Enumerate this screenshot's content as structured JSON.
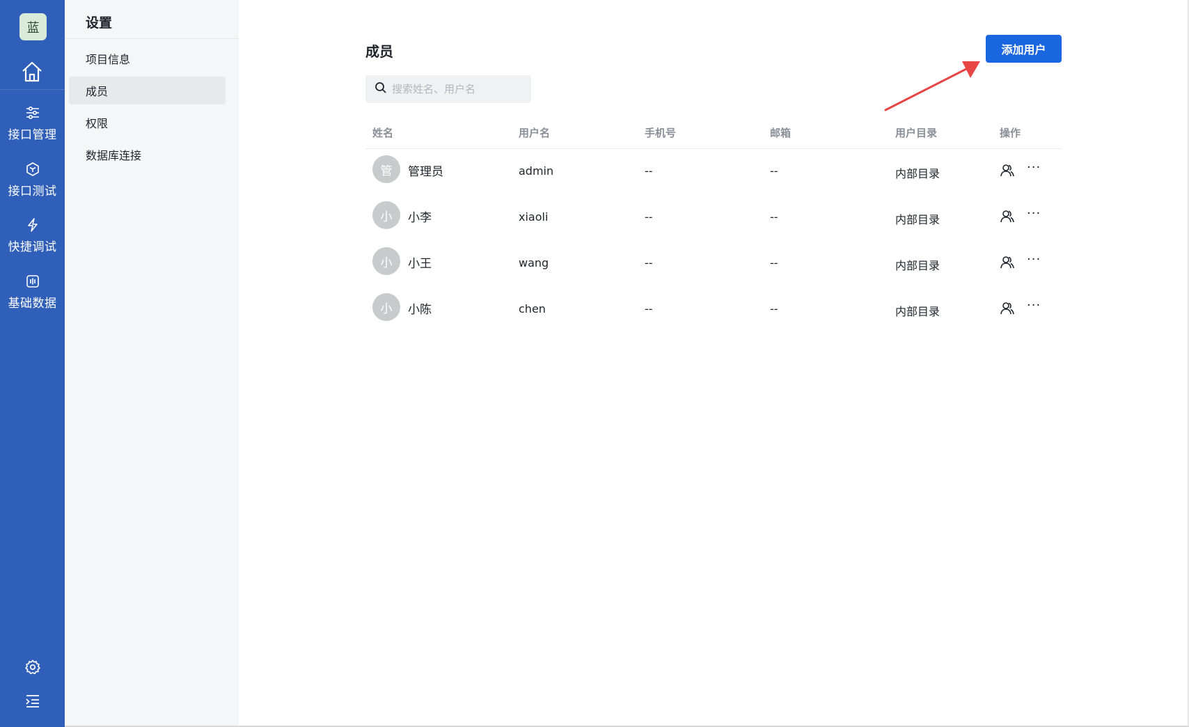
{
  "brand": {
    "label": "蓝"
  },
  "rail": {
    "items": [
      {
        "label": "接口管理",
        "icon": "sliders-icon"
      },
      {
        "label": "接口测试",
        "icon": "cube-icon"
      },
      {
        "label": "快捷调试",
        "icon": "lightning-icon"
      },
      {
        "label": "基础数据",
        "icon": "data-icon"
      }
    ],
    "bottom_icons": [
      "gear-icon",
      "menu-collapse-icon"
    ]
  },
  "settings": {
    "title": "设置",
    "items": [
      {
        "label": "项目信息"
      },
      {
        "label": "成员",
        "active": true
      },
      {
        "label": "权限"
      },
      {
        "label": "数据库连接"
      }
    ]
  },
  "members": {
    "title": "成员",
    "add_button": "添加用户",
    "search_placeholder": "搜索姓名、用户名",
    "columns": [
      "姓名",
      "用户名",
      "手机号",
      "邮箱",
      "用户目录",
      "操作"
    ],
    "rows": [
      {
        "avatar": "管",
        "name": "管理员",
        "username": "admin",
        "phone": "--",
        "email": "--",
        "directory": "内部目录"
      },
      {
        "avatar": "小",
        "name": "小李",
        "username": "xiaoli",
        "phone": "--",
        "email": "--",
        "directory": "内部目录"
      },
      {
        "avatar": "小",
        "name": "小王",
        "username": "wang",
        "phone": "--",
        "email": "--",
        "directory": "内部目录"
      },
      {
        "avatar": "小",
        "name": "小陈",
        "username": "chen",
        "phone": "--",
        "email": "--",
        "directory": "内部目录"
      }
    ],
    "more_glyph": "···"
  },
  "colors": {
    "rail_bg": "#2f5fb8",
    "primary": "#1a66e0",
    "annotation_arrow": "#e84545"
  }
}
